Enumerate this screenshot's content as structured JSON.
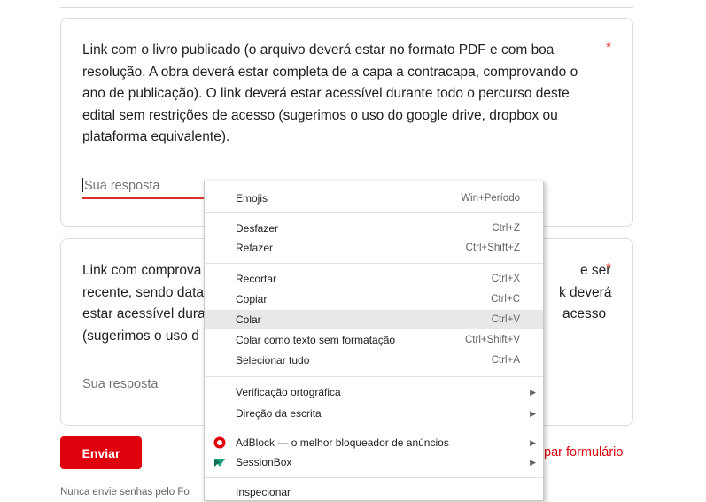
{
  "card1": {
    "question": "Link com o livro publicado (o arquivo deverá estar no formato PDF e com boa resolução. A obra deverá estar completa de a capa a contracapa, comprovando o ano de publicação).  O link deverá estar acessível durante todo o percurso deste edital sem restrições de acesso (sugerimos o uso do google drive, dropbox ou plataforma equivalente).",
    "required_mark": "*",
    "placeholder": "Sua resposta"
  },
  "card2": {
    "question_lines": [
      "Link com comprova",
      "recente, sendo data",
      "estar acessível dura",
      "(sugerimos o uso d"
    ],
    "question_right_lines": [
      "e ser",
      "k deverá",
      "acesso"
    ],
    "required_mark": "*",
    "placeholder": "Sua resposta"
  },
  "submit_label": "Enviar",
  "clear_form_partial": "par formulário",
  "footer_text": "Nunca envie senhas pelo Fo",
  "context_menu": {
    "items": [
      {
        "label": "Emojis",
        "shortcut": "Win+Período"
      },
      {
        "label": "Desfazer",
        "shortcut": "Ctrl+Z"
      },
      {
        "label": "Refazer",
        "shortcut": "Ctrl+Shift+Z"
      },
      {
        "label": "Recortar",
        "shortcut": "Ctrl+X"
      },
      {
        "label": "Copiar",
        "shortcut": "Ctrl+C"
      },
      {
        "label": "Colar",
        "shortcut": "Ctrl+V",
        "highlighted": true
      },
      {
        "label": "Colar como texto sem formatação",
        "shortcut": "Ctrl+Shift+V"
      },
      {
        "label": "Selecionar tudo",
        "shortcut": "Ctrl+A"
      },
      {
        "label": "Verificação ortográfica",
        "submenu": true
      },
      {
        "label": "Direção da escrita",
        "submenu": true
      },
      {
        "label": "AdBlock — o melhor bloqueador de anúncios",
        "submenu": true,
        "icon": "adblock-icon"
      },
      {
        "label": "SessionBox",
        "submenu": true,
        "icon": "sessionbox-icon"
      },
      {
        "label": "Inspecionar"
      }
    ]
  },
  "colors": {
    "accent": "#e0000c",
    "required": "#d93025",
    "menu_highlight": "#e8e8e8"
  }
}
